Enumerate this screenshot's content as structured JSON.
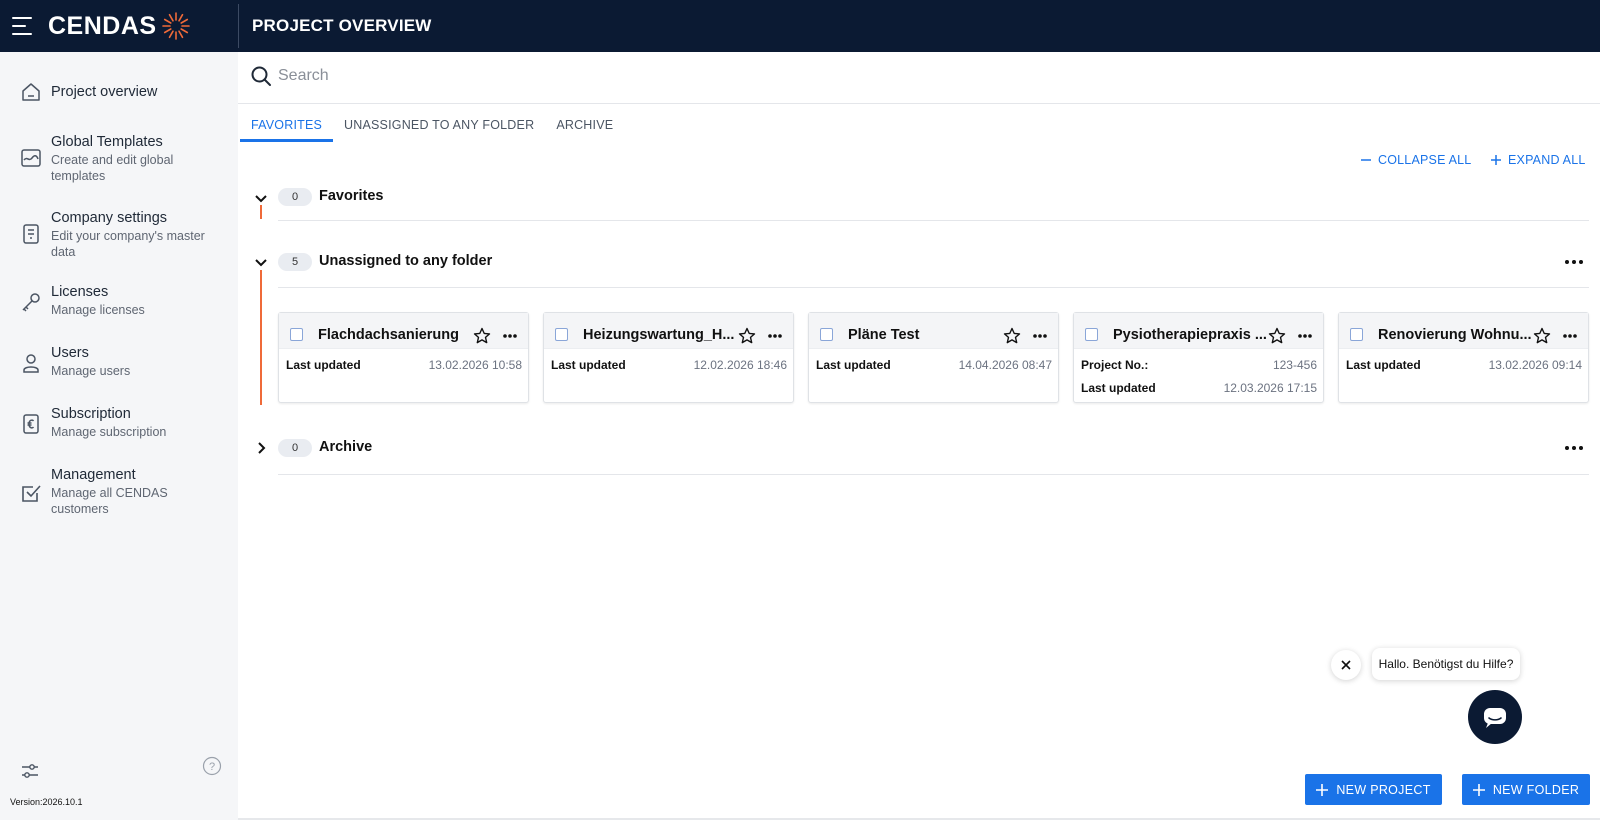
{
  "header": {
    "logo_text": "CENDAS",
    "title": "PROJECT OVERVIEW"
  },
  "sidebar": {
    "items": [
      {
        "title": "Project overview",
        "subtitle": "",
        "icon": "home-icon"
      },
      {
        "title": "Global Templates",
        "subtitle": "Create and edit global templates",
        "icon": "templates-icon"
      },
      {
        "title": "Company settings",
        "subtitle": "Edit your company's master data",
        "icon": "document-icon"
      },
      {
        "title": "Licenses",
        "subtitle": "Manage licenses",
        "icon": "key-icon"
      },
      {
        "title": "Users",
        "subtitle": "Manage users",
        "icon": "user-icon"
      },
      {
        "title": "Subscription",
        "subtitle": "Manage subscription",
        "icon": "euro-document-icon"
      },
      {
        "title": "Management",
        "subtitle": "Manage all CENDAS customers",
        "icon": "checkbox-icon"
      }
    ],
    "version": "Version:2026.10.1"
  },
  "search": {
    "placeholder": "Search",
    "value": ""
  },
  "tabs": [
    {
      "label": "FAVORITES",
      "active": true
    },
    {
      "label": "UNASSIGNED TO ANY FOLDER",
      "active": false
    },
    {
      "label": "ARCHIVE",
      "active": false
    }
  ],
  "actions": {
    "collapse_all": "COLLAPSE ALL",
    "expand_all": "EXPAND ALL"
  },
  "sections": [
    {
      "title": "Favorites",
      "count": "0",
      "expanded": true
    },
    {
      "title": "Unassigned to any folder",
      "count": "5",
      "expanded": true
    },
    {
      "title": "Archive",
      "count": "0",
      "expanded": false
    }
  ],
  "projects": [
    {
      "name": "Flachdachsanierung",
      "rows": [
        {
          "label": "Last updated",
          "value": "13.02.2026 10:58"
        }
      ]
    },
    {
      "name": "Heizungswartung_H...",
      "rows": [
        {
          "label": "Last updated",
          "value": "12.02.2026 18:46"
        }
      ]
    },
    {
      "name": "Pläne Test",
      "rows": [
        {
          "label": "Last updated",
          "value": "14.04.2026 08:47"
        }
      ]
    },
    {
      "name": "Pysiotherapiepraxis ...",
      "rows": [
        {
          "label": "Project No.:",
          "value": "123-456"
        },
        {
          "label": "Last updated",
          "value": "12.03.2026 17:15"
        }
      ]
    },
    {
      "name": "Renovierung Wohnu...",
      "rows": [
        {
          "label": "Last updated",
          "value": "13.02.2026 09:14"
        }
      ]
    }
  ],
  "chat": {
    "message": "Hallo. Benötigst du Hilfe?"
  },
  "buttons": {
    "new_project": "NEW PROJECT",
    "new_folder": "NEW FOLDER"
  },
  "colors": {
    "header_bg": "#0b1a33",
    "accent_blue": "#1a73e8",
    "brand_orange": "#ef6a39",
    "sidebar_bg": "#f5f6f8"
  }
}
